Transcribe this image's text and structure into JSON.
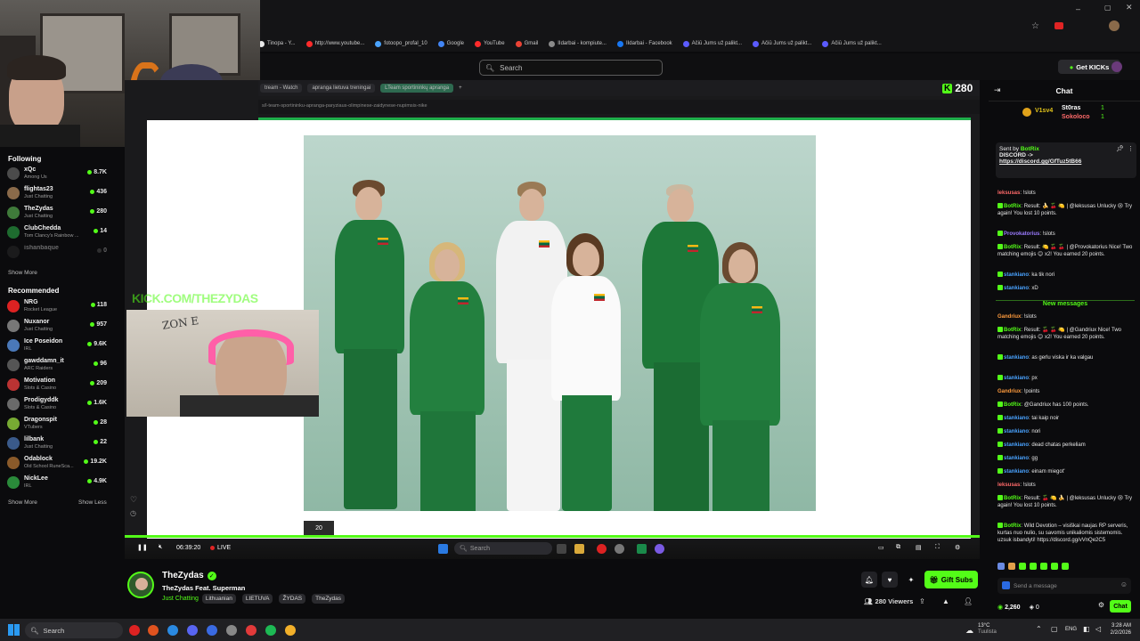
{
  "bookmarks": [
    {
      "label": "Tinopa - Y...",
      "color": "#e8e8e8"
    },
    {
      "label": "http://www.youtube...",
      "color": "#ff2b2b"
    },
    {
      "label": "fotoopo_profal_10",
      "color": "#4aa3ff"
    },
    {
      "label": "Google",
      "color": "#4285f4"
    },
    {
      "label": "YouTube",
      "color": "#ff2b2b"
    },
    {
      "label": "Gmail",
      "color": "#ea4335"
    },
    {
      "label": "IIdarbai - kompiute...",
      "color": "#8a8a8a"
    },
    {
      "label": "IIdarbai - Facebook",
      "color": "#1877f2"
    },
    {
      "label": "Ačiū Jums už palikt...",
      "color": "#5b5bff"
    },
    {
      "label": "Ačiū Jums už palikt...",
      "color": "#5b5bff"
    },
    {
      "label": "Ačiū Jums už palikt...",
      "color": "#5b5bff"
    }
  ],
  "header": {
    "search_placeholder": "Search",
    "get_kicks_label": "Get KICKs"
  },
  "sidebar": {
    "following_title": "Following",
    "following": [
      {
        "name": "xQc",
        "game": "Among Us",
        "viewers": "8.7K",
        "color": "#4b4b4b"
      },
      {
        "name": "flightas23",
        "game": "Just Chatting",
        "viewers": "436",
        "color": "#8a6a4a"
      },
      {
        "name": "TheZydas",
        "game": "Just Chatting",
        "viewers": "280",
        "color": "#3f7a3a"
      },
      {
        "name": "ClubChedda",
        "game": "Tom Clancy's Rainbow ...",
        "viewers": "14",
        "color": "#1e6b2f"
      },
      {
        "name": "ishanbaque",
        "game": "",
        "viewers": "0",
        "color": "#333"
      }
    ],
    "show_more": "Show More",
    "recommended_title": "Recommended",
    "recommended": [
      {
        "name": "NRG",
        "game": "Rocket League",
        "viewers": "118",
        "color": "#d22"
      },
      {
        "name": "Nuxanor",
        "game": "Just Chatting",
        "viewers": "957",
        "color": "#777"
      },
      {
        "name": "Ice Poseidon",
        "game": "IRL",
        "viewers": "9.6K",
        "color": "#4a78b8"
      },
      {
        "name": "gawddamn_it",
        "game": "ARC Raiders",
        "viewers": "96",
        "color": "#555"
      },
      {
        "name": "Motivation",
        "game": "Slots & Casino",
        "viewers": "209",
        "color": "#b33"
      },
      {
        "name": "Prodigyddk",
        "game": "Slots & Casino",
        "viewers": "1.6K",
        "color": "#6a6a6a"
      },
      {
        "name": "Dragonspit",
        "game": "VTubers",
        "viewers": "28",
        "color": "#7a3"
      },
      {
        "name": "lilbank",
        "game": "Just Chatting",
        "viewers": "22",
        "color": "#3a5a8a"
      },
      {
        "name": "Odablock",
        "game": "Old School RuneSca...",
        "viewers": "19.2K",
        "color": "#8a5a2a"
      },
      {
        "name": "NickLee",
        "game": "IRL",
        "viewers": "4.9K",
        "color": "#2a8a3a"
      }
    ],
    "show_more_2": "Show More",
    "show_less": "Show Less"
  },
  "stream": {
    "tabs": [
      "tream - Watch",
      "apranga lietuva treningai",
      "LTeam sportininkų apranga"
    ],
    "url": "s/l-team-sportininku-apranga-paryziaus-olimpinese-zaidynese-nupimsis-nike",
    "viewer_count": "280",
    "overlay_text": "KICK.COM/THEZYDAS",
    "page_number": "20",
    "uptime": "06:39:20",
    "live_label": "LIVE",
    "inner_search": "Search"
  },
  "channel": {
    "name": "TheZydas",
    "title": "TheZydas Feat. Superman",
    "category": "Just Chatting",
    "tags": [
      "Lithuanian",
      "LIETUVA",
      "ŽYDAS",
      "TheZydas"
    ],
    "gift_subs_label": "Gift Subs",
    "viewers_label": "280 Viewers"
  },
  "chat": {
    "title": "Chat",
    "leaderboard": [
      "V1sv4",
      "St0ras",
      "Sokoloco"
    ],
    "leader_values": [
      "1",
      "1"
    ],
    "pinned_sender": "Sent by",
    "pinned_user": "BotRix",
    "pinned_text": "DISCORD ->",
    "pinned_link": "https://discord.gg/GfTuz5tB66",
    "messages_before": [
      {
        "user": "leksusas",
        "text": "!slots",
        "color": "#ff6a6a"
      },
      {
        "user": "BotRix",
        "text": "Result: 🍌 🍒 🍋 | @leksusas Unlucky 😢 Try again! You lost 10 points.",
        "color": "#53fc18"
      },
      {
        "user": "Provokatorius",
        "text": "!slots",
        "color": "#9b7bff"
      },
      {
        "user": "BotRix",
        "text": "Result: 🍋 🍒 🍒 | @Provokatorius Nice! Two matching emojis 😊 x2! You earned 20 points.",
        "color": "#53fc18"
      },
      {
        "user": "stankiano",
        "text": "ka tik nori",
        "color": "#4aa3ff"
      },
      {
        "user": "stankiano",
        "text": "xD",
        "color": "#4aa3ff"
      }
    ],
    "new_messages_label": "New messages",
    "messages_after": [
      {
        "user": "Gandriux",
        "text": "!slots",
        "color": "#ff9b3d"
      },
      {
        "user": "BotRix",
        "text": "Result: 🍒 🍒 🍋 | @Gandriux Nice! Two matching emojis 😊 x2! You earned 20 points.",
        "color": "#53fc18"
      },
      {
        "user": "stankiano",
        "text": "as gerlu viska ir ka valgau",
        "color": "#4aa3ff"
      },
      {
        "user": "stankiano",
        "text": "px",
        "color": "#4aa3ff"
      },
      {
        "user": "Gandriux",
        "text": "!points",
        "color": "#ff9b3d"
      },
      {
        "user": "BotRix",
        "text": "@Gandriux has 100 points.",
        "color": "#53fc18"
      },
      {
        "user": "stankiano",
        "text": "tai kaip noir",
        "color": "#4aa3ff"
      },
      {
        "user": "stankiano",
        "text": "nori",
        "color": "#4aa3ff"
      },
      {
        "user": "stankiano",
        "text": "dead chatas perkeliam",
        "color": "#4aa3ff"
      },
      {
        "user": "stankiano",
        "text": "gg",
        "color": "#4aa3ff"
      },
      {
        "user": "stankiano",
        "text": "einam miegot'",
        "color": "#4aa3ff"
      },
      {
        "user": "leksusas",
        "text": "!slots",
        "color": "#ff6a6a"
      },
      {
        "user": "BotRix",
        "text": "Result: 🍒 🍋 🍌 | @leksusas Unlucky 😢 Try again! You lost 10 points.",
        "color": "#53fc18"
      },
      {
        "user": "BotRix",
        "text": "Wild Devotion – visiškai naujas RP serveris, kurtas nuo nulio, su savomis unikaliomis sistemomis. uzsuk isbandyti! https://discord.gg/vVnQe2C5",
        "color": "#53fc18"
      }
    ],
    "input_placeholder": "Send a message",
    "points": "2,260",
    "zero": "0",
    "chat_button": "Chat"
  },
  "taskbar": {
    "search_label": "Search",
    "weather_temp": "13°C",
    "weather_place": "Tuulista",
    "lang": "ENG",
    "time": "3:28 AM",
    "date": "2/2/2026"
  },
  "colors": {
    "kick_green": "#53fc18",
    "lt_yellow": "#fdb913",
    "lt_green": "#006a44",
    "lt_red": "#c1272d"
  }
}
